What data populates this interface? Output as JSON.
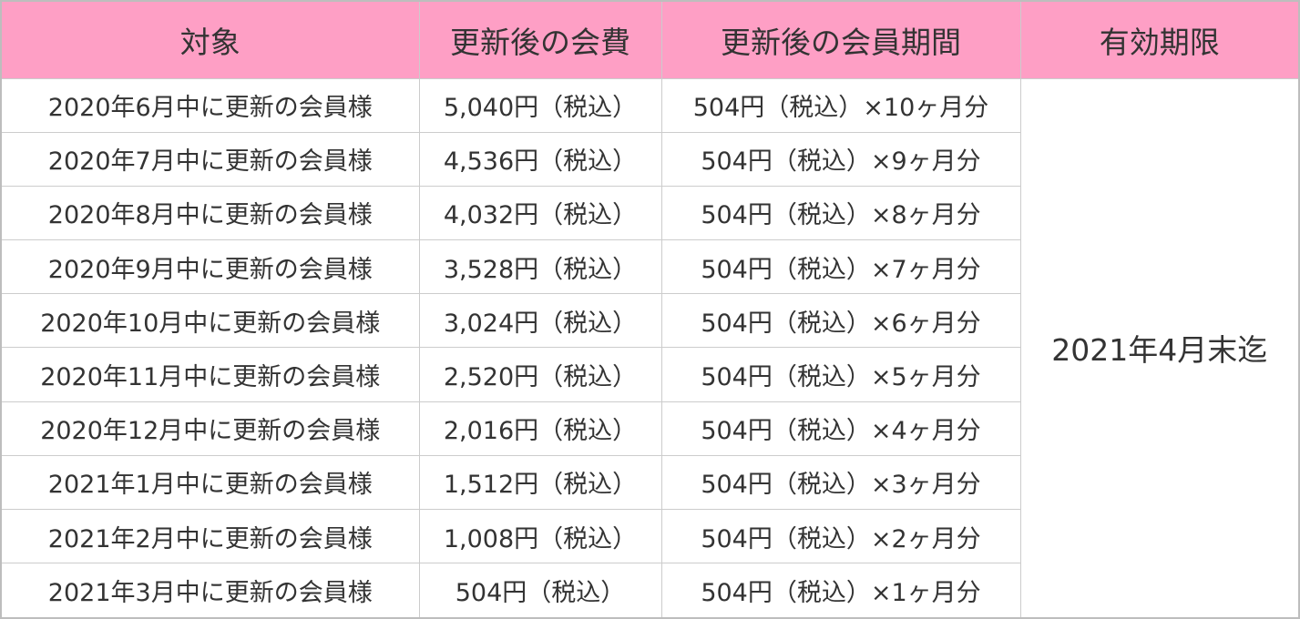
{
  "table": {
    "headers": [
      "対象",
      "更新後の会費",
      "更新後の会員期間",
      "有効期限"
    ],
    "rows": [
      {
        "target": "2020年6月中に更新の会員様",
        "fee": "5,040円（税込）",
        "period": "504円（税込）×10ヶ月分"
      },
      {
        "target": "2020年7月中に更新の会員様",
        "fee": "4,536円（税込）",
        "period": "504円（税込）×9ヶ月分"
      },
      {
        "target": "2020年8月中に更新の会員様",
        "fee": "4,032円（税込）",
        "period": "504円（税込）×8ヶ月分"
      },
      {
        "target": "2020年9月中に更新の会員様",
        "fee": "3,528円（税込）",
        "period": "504円（税込）×7ヶ月分"
      },
      {
        "target": "2020年10月中に更新の会員様",
        "fee": "3,024円（税込）",
        "period": "504円（税込）×6ヶ月分"
      },
      {
        "target": "2020年11月中に更新の会員様",
        "fee": "2,520円（税込）",
        "period": "504円（税込）×5ヶ月分"
      },
      {
        "target": "2020年12月中に更新の会員様",
        "fee": "2,016円（税込）",
        "period": "504円（税込）×4ヶ月分"
      },
      {
        "target": "2021年1月中に更新の会員様",
        "fee": "1,512円（税込）",
        "period": "504円（税込）×3ヶ月分"
      },
      {
        "target": "2021年2月中に更新の会員様",
        "fee": "1,008円（税込）",
        "period": "504円（税込）×2ヶ月分"
      },
      {
        "target": "2021年3月中に更新の会員様",
        "fee": "504円（税込）",
        "period": "504円（税込）×1ヶ月分"
      }
    ],
    "expiry": "2021年4月末迄"
  },
  "colors": {
    "header_bg": "#fe9fc5",
    "text": "#333333",
    "border": "#cccccc"
  }
}
